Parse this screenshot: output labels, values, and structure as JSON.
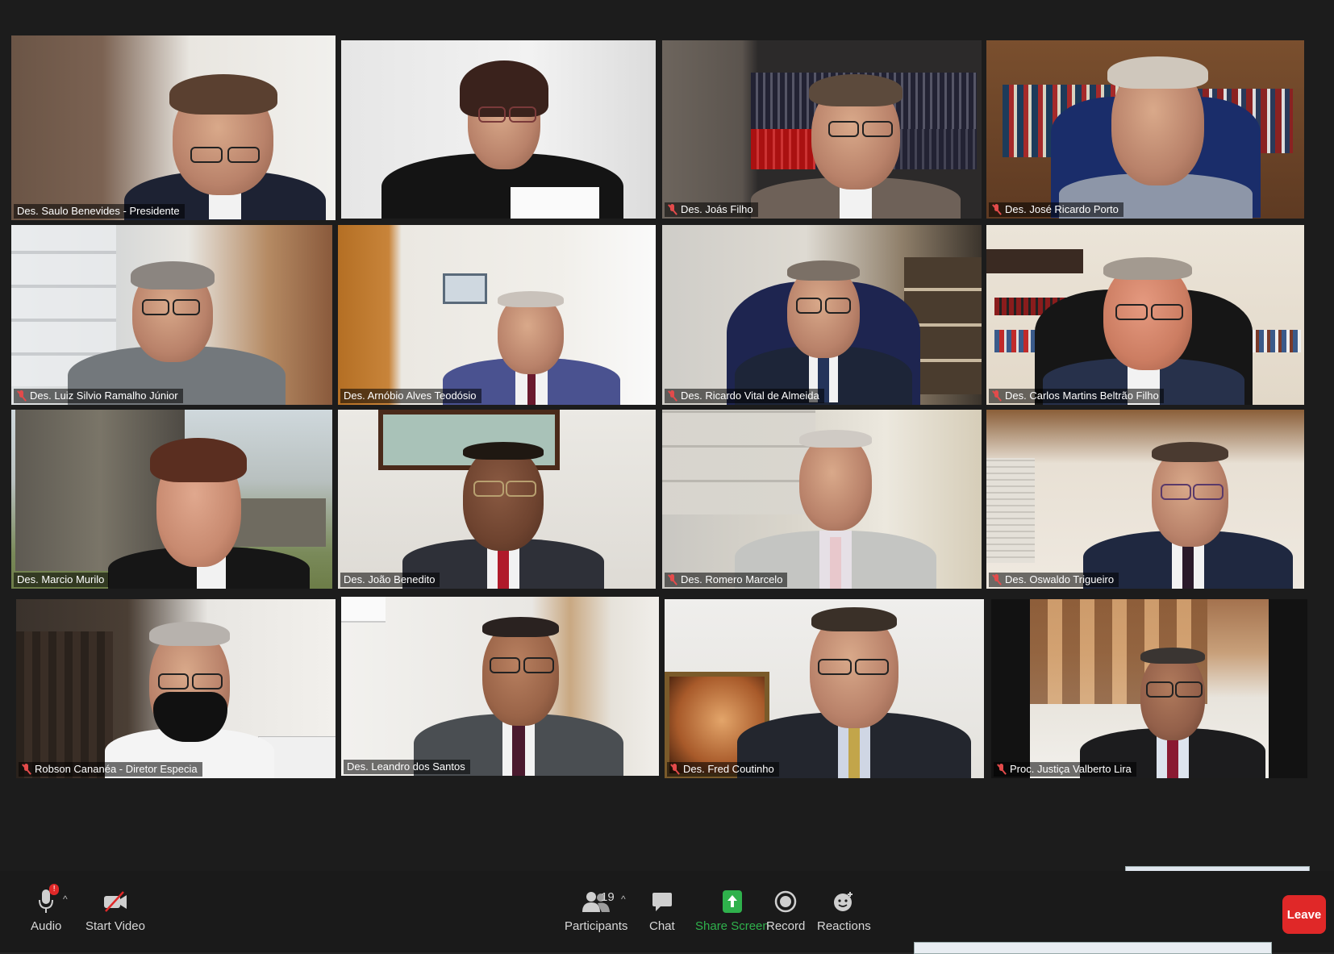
{
  "participants": [
    {
      "name": "Des. Saulo Benevides - Presidente",
      "muted": false,
      "active_speaker": true
    },
    {
      "name": "",
      "muted": false,
      "active_speaker": false
    },
    {
      "name": "Des. Joás Filho",
      "muted": true,
      "active_speaker": false
    },
    {
      "name": "Des. José Ricardo Porto",
      "muted": true,
      "active_speaker": false
    },
    {
      "name": "Des. Luiz Silvio Ramalho Júnior",
      "muted": true,
      "active_speaker": false
    },
    {
      "name": "Des. Arnóbio Alves Teodósio",
      "muted": false,
      "active_speaker": false
    },
    {
      "name": "Des. Ricardo Vital de Almeida",
      "muted": true,
      "active_speaker": false
    },
    {
      "name": "Des. Carlos Martins Beltrão Filho",
      "muted": true,
      "active_speaker": false
    },
    {
      "name": "Des. Marcio Murilo",
      "muted": false,
      "active_speaker": false
    },
    {
      "name": "Des. João Benedito",
      "muted": false,
      "active_speaker": false
    },
    {
      "name": "Des. Romero Marcelo",
      "muted": true,
      "active_speaker": false
    },
    {
      "name": "Des. Oswaldo Trigueiro",
      "muted": true,
      "active_speaker": false
    },
    {
      "name": "Robson Cananéa - Diretor Especia",
      "muted": true,
      "active_speaker": false
    },
    {
      "name": "Des. Leandro dos Santos",
      "muted": false,
      "active_speaker": false
    },
    {
      "name": "Des. Fred Coutinho",
      "muted": true,
      "active_speaker": false
    },
    {
      "name": "Proc. Justiça Valberto Lira",
      "muted": true,
      "active_speaker": false
    }
  ],
  "toolbar": {
    "audio_label": "Audio",
    "audio_badge": "!",
    "video_label": "Start Video",
    "participants_label": "Participants",
    "participants_count": "19",
    "chat_label": "Chat",
    "share_label": "Share Screen",
    "record_label": "Record",
    "reactions_label": "Reactions",
    "leave_label": "Leave",
    "caret": "^"
  },
  "colors": {
    "active_speaker_border": "#d4e64a",
    "share_green": "#2fb14c",
    "leave_red": "#e02828",
    "muted_red": "#e34b4b"
  },
  "icons": [
    "microphone-icon",
    "video-off-icon",
    "participants-icon",
    "chat-icon",
    "share-screen-icon",
    "record-icon",
    "reactions-icon"
  ]
}
